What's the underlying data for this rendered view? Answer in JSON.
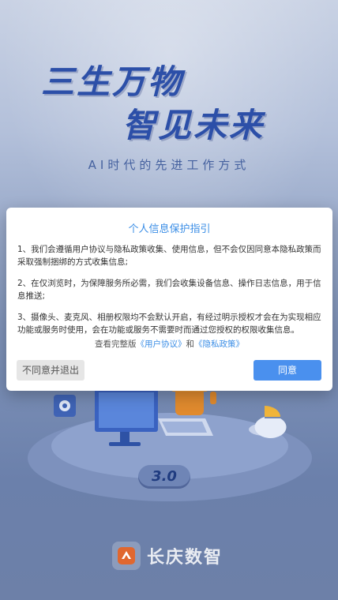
{
  "hero": {
    "slogan_line1": "三生万物",
    "slogan_line2": "智见未来",
    "subtitle": "AI时代的先进工作方式"
  },
  "illustration": {
    "version": "3.0"
  },
  "brand": {
    "name": "长庆数智"
  },
  "dialog": {
    "title": "个人信息保护指引",
    "paragraphs": [
      "1、我们会遵循用户协议与隐私政策收集、使用信息，但不会仅因同意本隐私政策而采取强制捆绑的方式收集信息;",
      "2、在仅浏览时，为保障服务所必需，我们会收集设备信息、操作日志信息，用于信息推送;",
      "3、摄像头、麦克风、相册权限均不会默认开启，有经过明示授权才会在为实现相应功能或服务时使用，会在功能或服务不需要时而通过您授权的权限收集信息。"
    ],
    "links_prefix": "查看完整版",
    "user_agreement_link": "《用户协议》",
    "links_conjunction": "和",
    "privacy_policy_link": "《隐私政策》",
    "decline_label": "不同意并退出",
    "agree_label": "同意"
  },
  "colors": {
    "accent": "#4a90ee",
    "title_blue": "#3b8ee6",
    "slogan_blue": "#2c4fa8"
  }
}
